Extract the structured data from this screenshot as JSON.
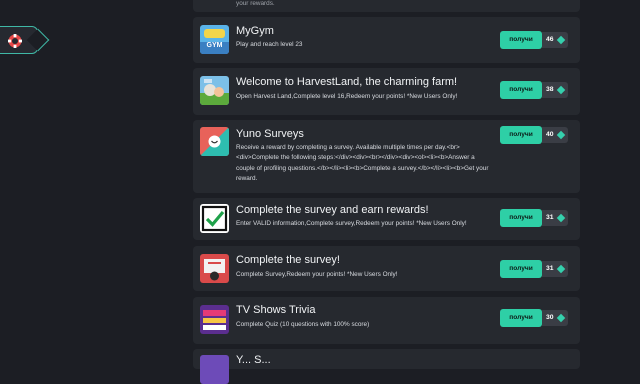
{
  "help": {
    "icon": "lifebuoy-icon",
    "accent": "#3fb8a6"
  },
  "offers": [
    {
      "thumb": "partial",
      "title": "",
      "desc": "your rewards.",
      "btn": "",
      "points": ""
    },
    {
      "thumb": "mygym",
      "title": "MyGym",
      "desc": "Play and reach level 23",
      "btn": "получи",
      "points": "46"
    },
    {
      "thumb": "harvest",
      "title": "Welcome to HarvestLand, the charming farm!",
      "desc": "Open Harvest Land,Complete level 16,Redeem your points! *New Users Only!",
      "btn": "получи",
      "points": "38"
    },
    {
      "thumb": "yuno",
      "title": "Yuno Surveys",
      "desc": "Receive a reward by completing a survey. Available multiple times per day.<br><div>Complete the following steps:</div><div><br></div><div><ol><li><b>Answer a couple of profiling questions.</b></li><li><b>Complete a survey.</b></li><li><b>Get your reward.",
      "btn": "получи",
      "points": "40"
    },
    {
      "thumb": "check",
      "title": "Complete the survey and earn rewards!",
      "desc": "Enter VALID information,Complete survey,Redeem your points! *New Users Only!",
      "btn": "получи",
      "points": "31"
    },
    {
      "thumb": "survey",
      "title": "Complete the survey!",
      "desc": "Complete Survey,Redeem your points! *New Users Only!",
      "btn": "получи",
      "points": "31"
    },
    {
      "thumb": "tvshows",
      "title": "TV Shows Trivia",
      "desc": "Complete Quiz (10 questions with 100% score)",
      "btn": "получи",
      "points": "30"
    },
    {
      "thumb": "partial2",
      "title": "Y... S...",
      "desc": "",
      "btn": "",
      "points": ""
    }
  ],
  "colors": {
    "background": "#1c1e24",
    "card": "#26292f",
    "button": "#2ecfa6",
    "points_bg": "#3a3d45",
    "gem": "#35d0ad"
  }
}
